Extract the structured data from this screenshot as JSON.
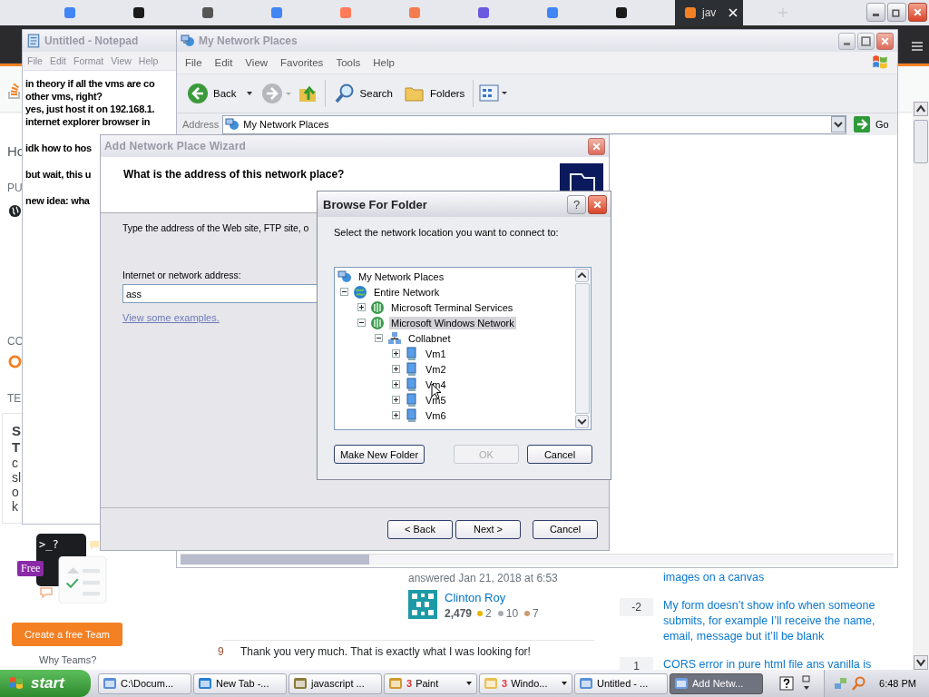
{
  "browser": {
    "tabs": [
      {
        "kind": "google",
        "selected": false
      },
      {
        "kind": "dark",
        "selected": false
      },
      {
        "kind": "gray",
        "selected": false
      },
      {
        "kind": "google",
        "selected": false
      },
      {
        "kind": "orange",
        "selected": false
      },
      {
        "kind": "orange-outline",
        "selected": false
      },
      {
        "kind": "violet",
        "selected": false
      },
      {
        "kind": "google",
        "selected": false
      },
      {
        "kind": "dark",
        "selected": false
      },
      {
        "kind": "stack",
        "label": "jav",
        "selected": true
      }
    ]
  },
  "page": {
    "fragments": [
      "Ho",
      "PU",
      "CO",
      "TE"
    ],
    "card_fragments": [
      "S",
      "T",
      "c",
      "sl",
      "o",
      "k"
    ],
    "promo": {
      "prompt": ">_?",
      "badge": "Free",
      "button": "Create a free Team",
      "link": "Why Teams?"
    },
    "answer": {
      "meta": "answered Jan 21, 2018 at 6:53",
      "user": "Clinton Roy",
      "reputation": "2,479",
      "badges": [
        {
          "count": "2",
          "color": "#e8b400"
        },
        {
          "count": "10",
          "color": "#a8adb3"
        },
        {
          "count": "7",
          "color": "#c99a70"
        }
      ]
    },
    "comment": {
      "score": "9",
      "text": "Thank you very much. That is exactly what I was looking for!"
    },
    "related": [
      {
        "title": "images on a canvas"
      },
      {
        "score": "-2",
        "title": "My form doesn’t show info when someone submits, for example I’ll receive the name, email, message but it’ll be blank"
      },
      {
        "score": "1",
        "title": "CORS error in pure html file ans vanilla is"
      }
    ]
  },
  "notepad": {
    "title": "Untitled - Notepad",
    "menu": [
      "File",
      "Edit",
      "Format",
      "View",
      "Help"
    ],
    "paragraphs": [
      [
        "in theory if all the vms are co",
        "other vms, right?",
        "yes, just host it on 192.168.1.",
        "internet explorer browser in"
      ],
      [
        "idk how to hos"
      ],
      [
        "but wait, this u"
      ],
      [
        "new idea: wha"
      ]
    ]
  },
  "explorer": {
    "title": "My Network Places",
    "menu": [
      "File",
      "Edit",
      "View",
      "Favorites",
      "Tools",
      "Help"
    ],
    "toolbar": {
      "back": "Back",
      "search": "Search",
      "folders": "Folders"
    },
    "address_label": "Address",
    "address": "My Network Places",
    "go": "Go"
  },
  "wizard": {
    "title": "Add Network Place Wizard",
    "heading": "What is the address of this network place?",
    "intro": "Type the address of the Web site, FTP site, o",
    "field_label": "Internet or network address:",
    "field_value": "ass",
    "link": "View some examples.",
    "buttons": [
      "< Back",
      "Next >",
      "Cancel"
    ]
  },
  "browse": {
    "title": "Browse For Folder",
    "help": "?",
    "prompt": "Select the network location you want to connect to:",
    "tree": [
      {
        "label": "My Network Places",
        "kind": "places",
        "selected": false,
        "children": [
          {
            "label": "Entire Network",
            "kind": "globe",
            "expanded": true,
            "selected": false,
            "children": [
              {
                "label": "Microsoft Terminal Services",
                "kind": "network",
                "expanded": false,
                "selected": false
              },
              {
                "label": "Microsoft Windows Network",
                "kind": "network",
                "expanded": true,
                "selected": true,
                "children": [
                  {
                    "label": "Collabnet",
                    "kind": "workgroup",
                    "expanded": true,
                    "selected": false,
                    "children": [
                      {
                        "label": "Vm1",
                        "kind": "computer",
                        "expanded": false,
                        "selected": false
                      },
                      {
                        "label": "Vm2",
                        "kind": "computer",
                        "expanded": false,
                        "selected": false
                      },
                      {
                        "label": "Vm4",
                        "kind": "computer",
                        "expanded": false,
                        "selected": false
                      },
                      {
                        "label": "Vm5",
                        "kind": "computer",
                        "expanded": false,
                        "selected": false
                      },
                      {
                        "label": "Vm6",
                        "kind": "computer",
                        "expanded": false,
                        "selected": false
                      }
                    ]
                  }
                ]
              }
            ]
          }
        ]
      }
    ],
    "buttons": [
      {
        "label": "Make New Folder",
        "disabled": false
      },
      {
        "label": "OK",
        "disabled": true
      },
      {
        "label": "Cancel",
        "disabled": false
      }
    ]
  },
  "taskbar": {
    "start": "start",
    "tasks": [
      {
        "kind": "notepad",
        "label": "C:\\Docum...",
        "selected": false
      },
      {
        "kind": "ie",
        "label": "New Tab -...",
        "selected": false
      },
      {
        "kind": "app",
        "label": "javascript ...",
        "selected": false
      },
      {
        "kind": "paint",
        "count": "3",
        "label": "Paint",
        "selected": false
      },
      {
        "kind": "folder",
        "count": "3",
        "label": "Windo...",
        "selected": false
      },
      {
        "kind": "notepad",
        "label": "Untitled - ...",
        "selected": false
      },
      {
        "kind": "window",
        "label": "Add Netw...",
        "selected": true
      }
    ],
    "time": "6:48 PM"
  }
}
